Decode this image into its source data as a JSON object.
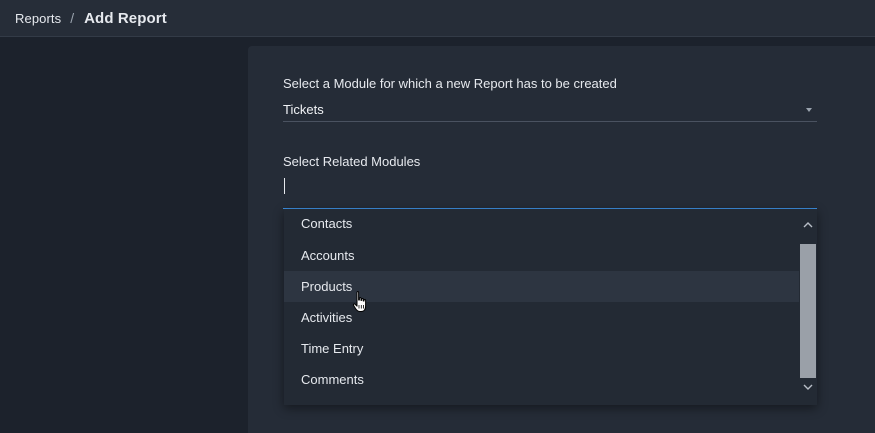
{
  "breadcrumb": {
    "root": "Reports",
    "separator": "/",
    "current": "Add Report"
  },
  "form": {
    "module_label": "Select a Module for which a new Report has to be created",
    "module_value": "Tickets",
    "related_label": "Select Related Modules",
    "related_value": ""
  },
  "dropdown": {
    "options": [
      "Contacts",
      "Accounts",
      "Products",
      "Activities",
      "Time Entry",
      "Comments"
    ],
    "hovered": "Products"
  },
  "colors": {
    "accent": "#3d8fe0",
    "panel": "#252c37",
    "background": "#1c222c"
  },
  "icons": {
    "select_caret": "caret-down-icon",
    "scroll_up": "chevron-up-icon",
    "scroll_down": "chevron-down-icon",
    "pointer": "hand-pointer-icon"
  }
}
